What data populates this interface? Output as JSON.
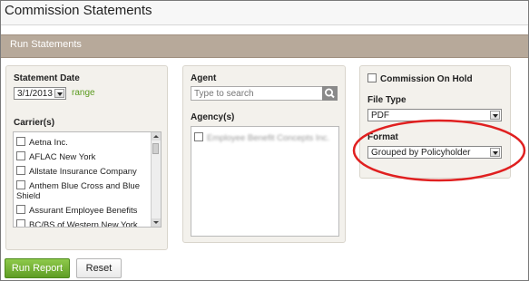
{
  "window": {
    "title": "Commission Statements"
  },
  "section": {
    "title": "Run Statements"
  },
  "statement_date": {
    "label": "Statement Date",
    "value": "3/1/2013",
    "range_link": "range"
  },
  "carrier": {
    "label": "Carrier(s)",
    "items": [
      {
        "label": "Aetna Inc."
      },
      {
        "label": "AFLAC New York"
      },
      {
        "label": "Allstate Insurance Company"
      },
      {
        "label": "Anthem Blue Cross and Blue Shield"
      },
      {
        "label": "Assurant Employee Benefits"
      },
      {
        "label": "BC/BS of Western New York"
      }
    ]
  },
  "agent": {
    "label": "Agent",
    "placeholder": "Type to search"
  },
  "agency": {
    "label": "Agency(s)",
    "items": [
      {
        "label": "Employee Benefit Concepts Inc."
      }
    ]
  },
  "commission_on_hold": {
    "label": "Commission On Hold"
  },
  "file_type": {
    "label": "File Type",
    "value": "PDF"
  },
  "format": {
    "label": "Format",
    "value": "Grouped by Policyholder"
  },
  "buttons": {
    "run_report": "Run Report",
    "reset": "Reset"
  },
  "colors": {
    "accent_green": "#6aaa2c",
    "section_bar": "#b7a99a",
    "highlight_ellipse": "#e02020"
  },
  "icons": {
    "search": "search-icon",
    "dropdown": "chevron-down-icon"
  }
}
